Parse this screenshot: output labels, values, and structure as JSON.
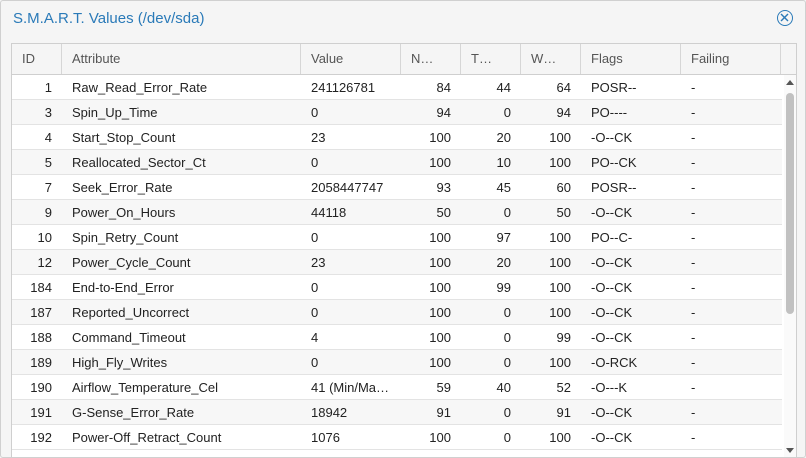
{
  "window": {
    "title": "S.M.A.R.T. Values (/dev/sda)"
  },
  "columns": [
    "ID",
    "Attribute",
    "Value",
    "N…",
    "T…",
    "W…",
    "Flags",
    "Failing"
  ],
  "rows": [
    {
      "id": "1",
      "attr": "Raw_Read_Error_Rate",
      "value": "241126781",
      "n": "84",
      "t": "44",
      "w": "64",
      "flags": "POSR--",
      "failing": "-"
    },
    {
      "id": "3",
      "attr": "Spin_Up_Time",
      "value": "0",
      "n": "94",
      "t": "0",
      "w": "94",
      "flags": "PO----",
      "failing": "-"
    },
    {
      "id": "4",
      "attr": "Start_Stop_Count",
      "value": "23",
      "n": "100",
      "t": "20",
      "w": "100",
      "flags": "-O--CK",
      "failing": "-"
    },
    {
      "id": "5",
      "attr": "Reallocated_Sector_Ct",
      "value": "0",
      "n": "100",
      "t": "10",
      "w": "100",
      "flags": "PO--CK",
      "failing": "-"
    },
    {
      "id": "7",
      "attr": "Seek_Error_Rate",
      "value": "2058447747",
      "n": "93",
      "t": "45",
      "w": "60",
      "flags": "POSR--",
      "failing": "-"
    },
    {
      "id": "9",
      "attr": "Power_On_Hours",
      "value": "44118",
      "n": "50",
      "t": "0",
      "w": "50",
      "flags": "-O--CK",
      "failing": "-"
    },
    {
      "id": "10",
      "attr": "Spin_Retry_Count",
      "value": "0",
      "n": "100",
      "t": "97",
      "w": "100",
      "flags": "PO--C-",
      "failing": "-"
    },
    {
      "id": "12",
      "attr": "Power_Cycle_Count",
      "value": "23",
      "n": "100",
      "t": "20",
      "w": "100",
      "flags": "-O--CK",
      "failing": "-"
    },
    {
      "id": "184",
      "attr": "End-to-End_Error",
      "value": "0",
      "n": "100",
      "t": "99",
      "w": "100",
      "flags": "-O--CK",
      "failing": "-"
    },
    {
      "id": "187",
      "attr": "Reported_Uncorrect",
      "value": "0",
      "n": "100",
      "t": "0",
      "w": "100",
      "flags": "-O--CK",
      "failing": "-"
    },
    {
      "id": "188",
      "attr": "Command_Timeout",
      "value": "4",
      "n": "100",
      "t": "0",
      "w": "99",
      "flags": "-O--CK",
      "failing": "-"
    },
    {
      "id": "189",
      "attr": "High_Fly_Writes",
      "value": "0",
      "n": "100",
      "t": "0",
      "w": "100",
      "flags": "-O-RCK",
      "failing": "-"
    },
    {
      "id": "190",
      "attr": "Airflow_Temperature_Cel",
      "value": "41 (Min/Ma…",
      "n": "59",
      "t": "40",
      "w": "52",
      "flags": "-O---K",
      "failing": "-"
    },
    {
      "id": "191",
      "attr": "G-Sense_Error_Rate",
      "value": "18942",
      "n": "91",
      "t": "0",
      "w": "91",
      "flags": "-O--CK",
      "failing": "-"
    },
    {
      "id": "192",
      "attr": "Power-Off_Retract_Count",
      "value": "1076",
      "n": "100",
      "t": "0",
      "w": "100",
      "flags": "-O--CK",
      "failing": "-"
    }
  ],
  "icons": {
    "close": "close-circle-icon",
    "scroll_up": "arrow-up-icon",
    "scroll_down": "arrow-down-icon"
  },
  "colors": {
    "accent": "#2a7ab8"
  }
}
